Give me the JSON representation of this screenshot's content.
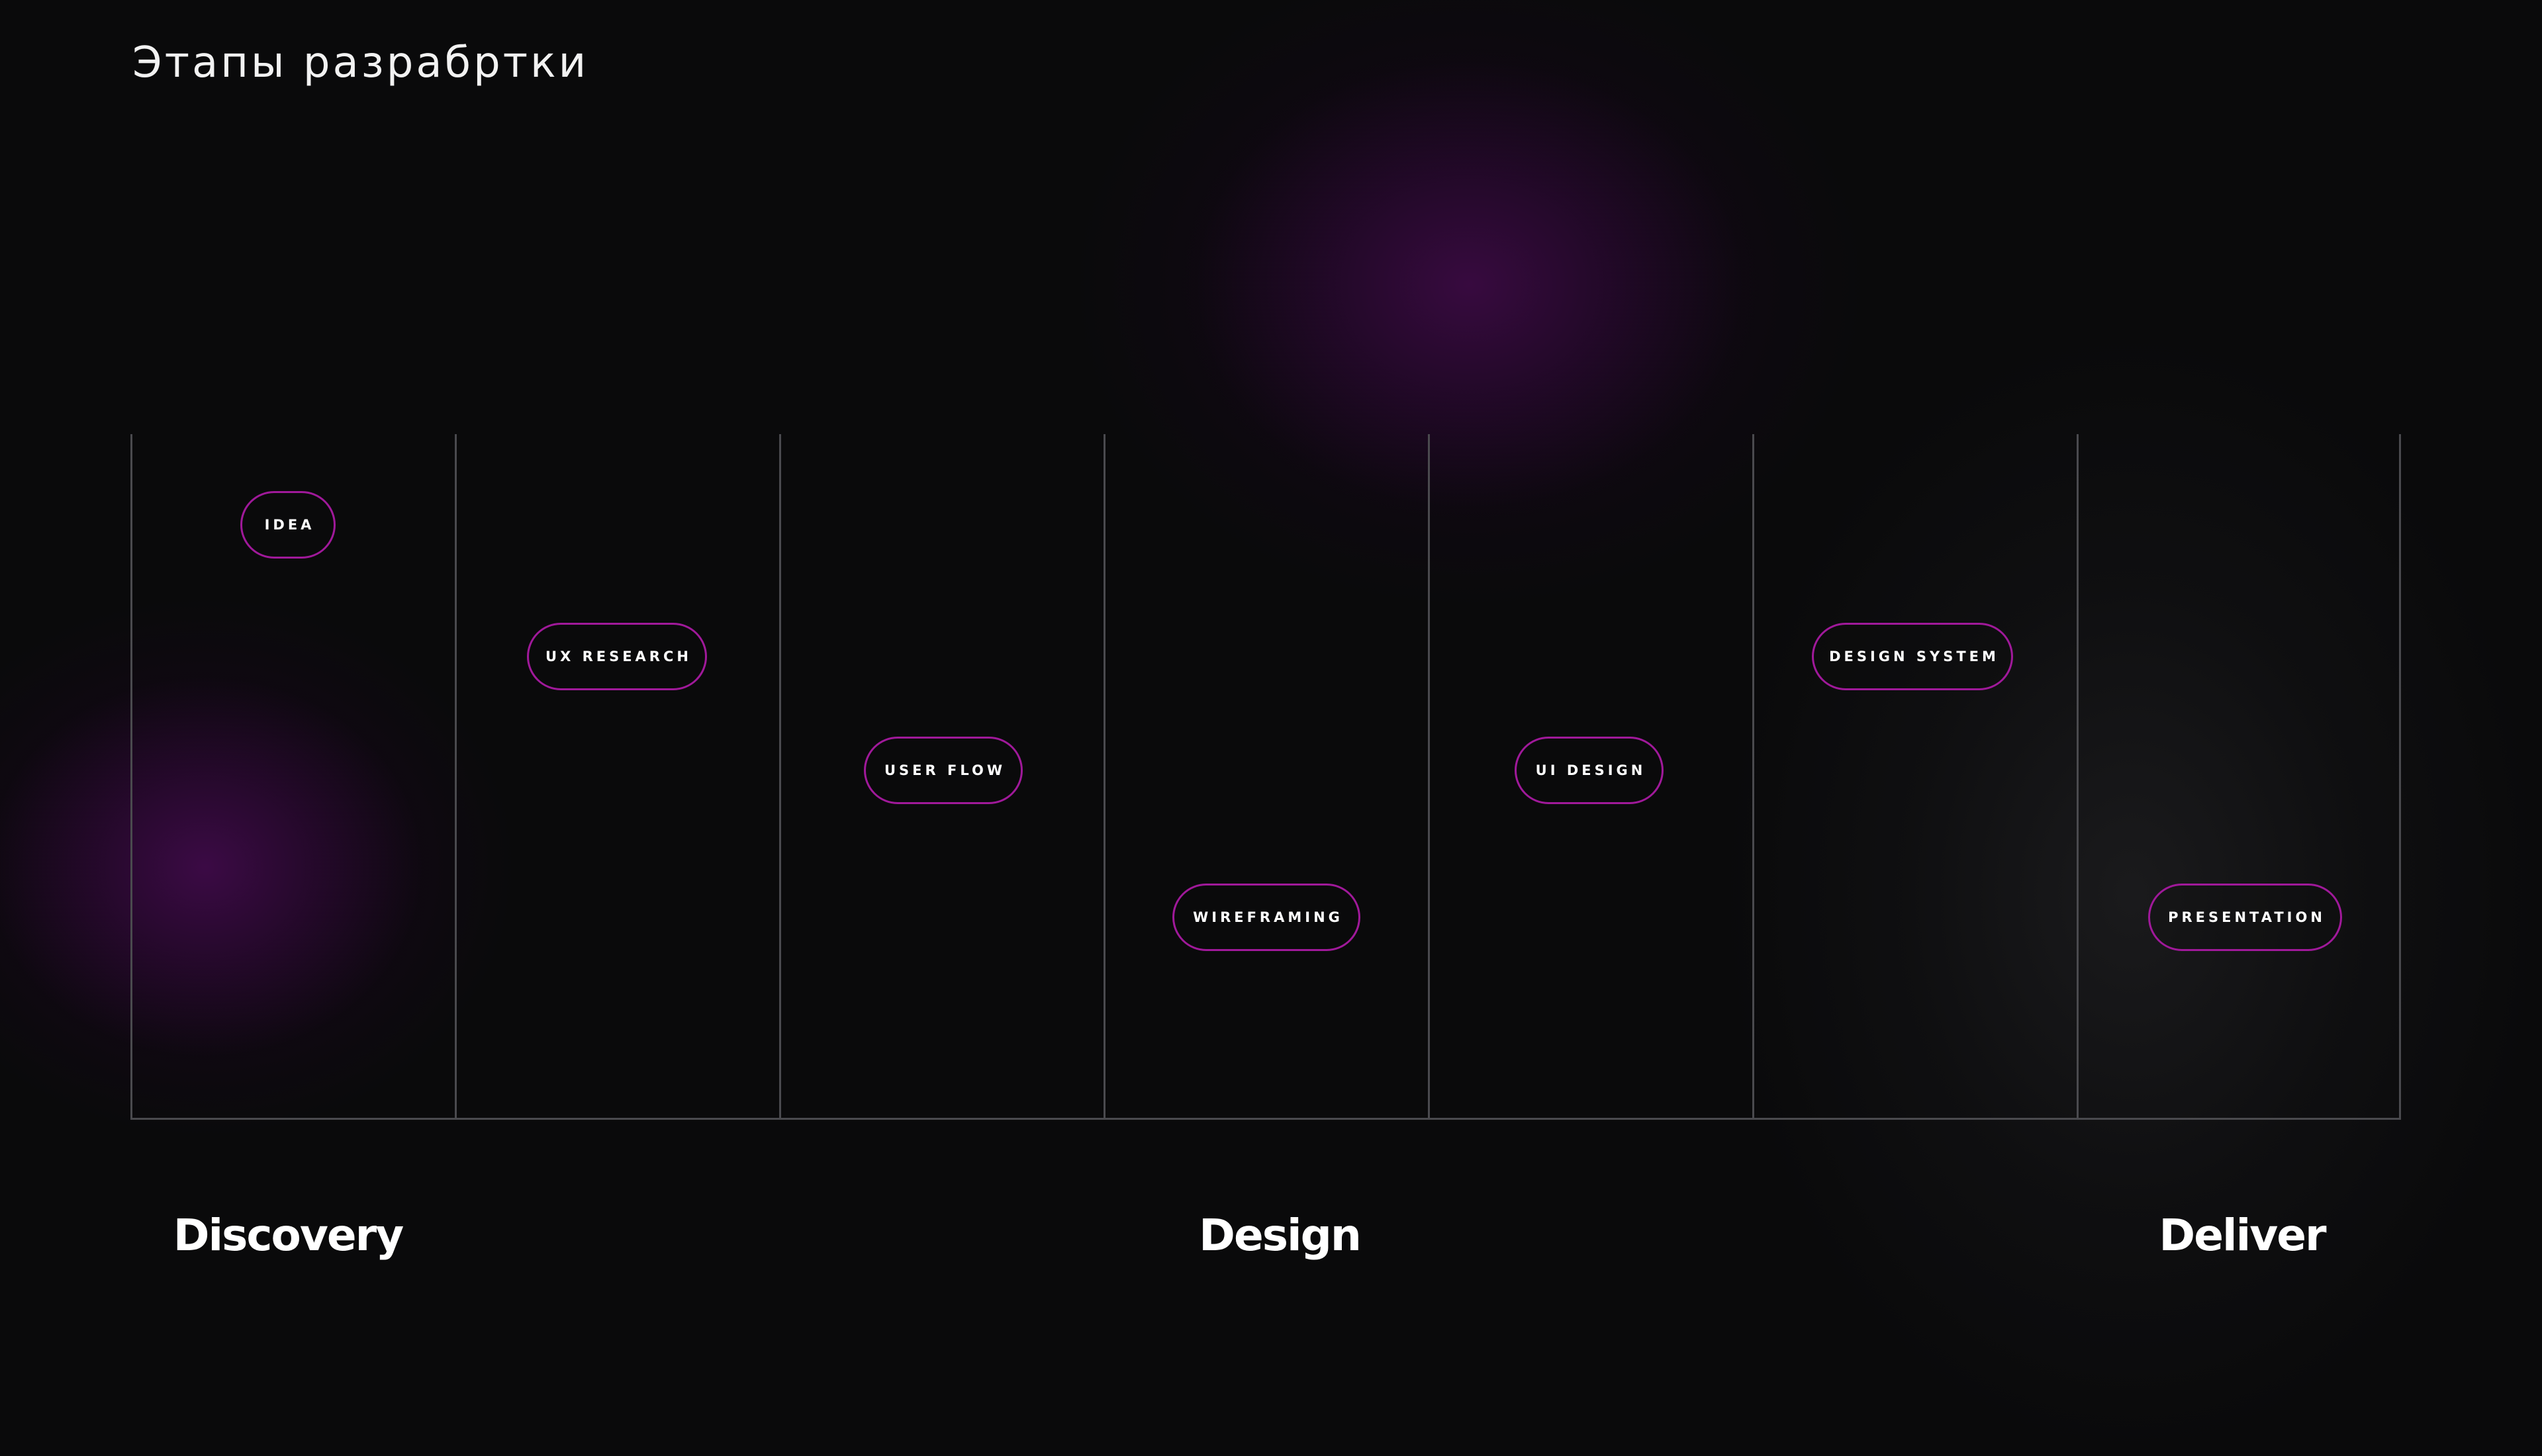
{
  "title": "Этапы разрабртки",
  "colors": {
    "background": "#0a0a0b",
    "accent": "#a0199a",
    "grid_line": "#4a4a4e",
    "glow": "#3a0a42"
  },
  "steps": [
    {
      "label": "IDEA"
    },
    {
      "label": "UX RESEARCH"
    },
    {
      "label": "USER FLOW"
    },
    {
      "label": "WIREFRAMING"
    },
    {
      "label": "UI DESIGN"
    },
    {
      "label": "DESIGN SYSTEM"
    },
    {
      "label": "PRESENTATION"
    }
  ],
  "phases": [
    {
      "label": "Discovery"
    },
    {
      "label": "Design"
    },
    {
      "label": "Deliver"
    }
  ]
}
